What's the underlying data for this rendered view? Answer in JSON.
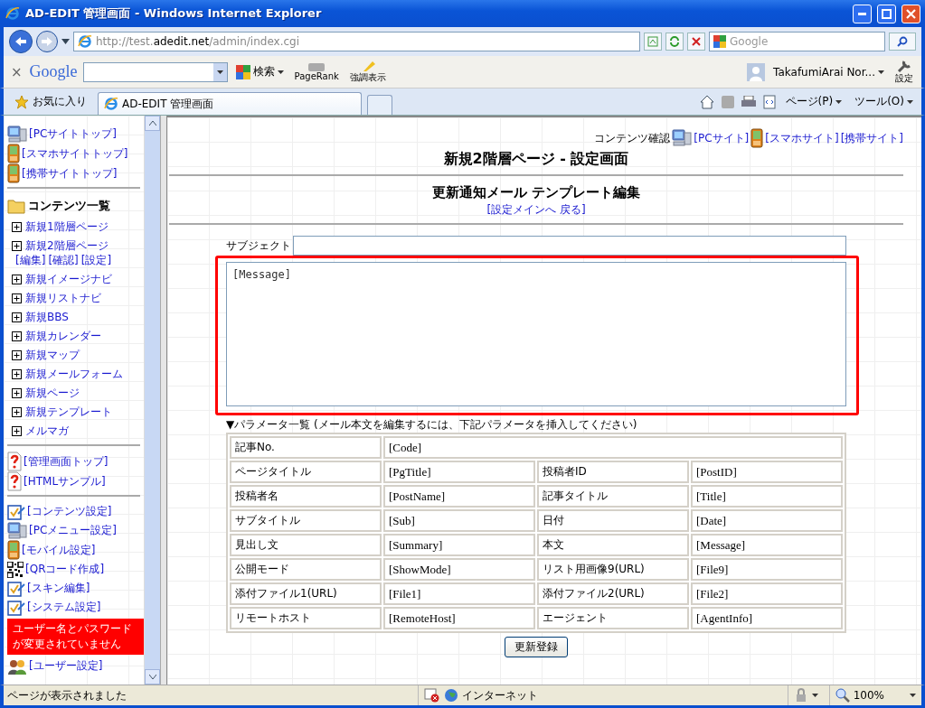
{
  "window": {
    "title": "AD-EDIT 管理画面 - Windows Internet Explorer"
  },
  "address_bar": {
    "url_prefix": "http://test.",
    "url_domain": "adedit.net",
    "url_path": "/admin/index.cgi"
  },
  "search_box": {
    "placeholder": "Google"
  },
  "google_toolbar": {
    "close": "×",
    "logo": "Google",
    "search_button": "検索",
    "pagerank": "PageRank",
    "highlight": "強調表示",
    "user": "TakafumiArai Nor...",
    "settings": "設定"
  },
  "tab_bar": {
    "favorites": "お気に入り",
    "tabs": [
      {
        "label": "AD-EDIT 管理画面",
        "selected": true
      }
    ],
    "page_menu": "ページ(P)",
    "tools_menu": "ツール(O)"
  },
  "sidebar": {
    "top_links": [
      {
        "kind": "pc",
        "label": "[PCサイトトップ]"
      },
      {
        "kind": "phone",
        "label": "[スマホサイトトップ]"
      },
      {
        "kind": "phone",
        "label": "[携帯サイトトップ]"
      }
    ],
    "contents": {
      "heading": "コンテンツ一覧",
      "items": [
        {
          "label": "新規1階層ページ",
          "expanded": false
        },
        {
          "label": "新規2階層ページ",
          "expanded": false,
          "actions": [
            "[編集]",
            "[確認]",
            "[設定]"
          ]
        },
        {
          "label": "新規イメージナビ",
          "expanded": false
        },
        {
          "label": "新規リストナビ",
          "expanded": false
        },
        {
          "label": "新規BBS",
          "expanded": false
        },
        {
          "label": "新規カレンダー",
          "expanded": false
        },
        {
          "label": "新規マップ",
          "expanded": false
        },
        {
          "label": "新規メールフォーム",
          "expanded": false
        },
        {
          "label": "新規ページ",
          "expanded": false
        },
        {
          "label": "新規テンプレート",
          "expanded": false
        },
        {
          "label": "メルマガ",
          "expanded": false
        }
      ]
    },
    "help_links": [
      {
        "kind": "help",
        "label": "[管理画面トップ]"
      },
      {
        "kind": "help",
        "label": "[HTMLサンプル]"
      }
    ],
    "settings_links": [
      {
        "kind": "check",
        "label": "[コンテンツ設定]"
      },
      {
        "kind": "pc",
        "label": "[PCメニュー設定]"
      },
      {
        "kind": "phone",
        "label": "[モバイル設定]"
      },
      {
        "kind": "qr",
        "label": "[QRコード作成]"
      },
      {
        "kind": "check",
        "label": "[スキン編集]"
      },
      {
        "kind": "check",
        "label": "[システム設定]"
      },
      {
        "kind": "warning",
        "label": "ユーザー名とパスワードが変更されていません"
      },
      {
        "kind": "users",
        "label": "[ユーザー設定]"
      }
    ]
  },
  "main": {
    "check_label": "コンテンツ確認",
    "check_links": [
      {
        "kind": "pc",
        "label": "[PCサイト]"
      },
      {
        "kind": "phone",
        "label": "[スマホサイト]"
      },
      {
        "kind": "none",
        "label": "[携帯サイト]"
      }
    ],
    "title": "新規2階層ページ - 設定画面",
    "subtitle": "更新通知メール テンプレート編集",
    "back_link": "[設定メインへ 戻る]",
    "subject_label": "サブジェクト",
    "body_value": "[Message]",
    "params_heading": "▼パラメータ一覧 (メール本文を編集するには、下記パラメータを挿入してください)",
    "params": [
      [
        "記事No.",
        "[Code]"
      ],
      [
        "ページタイトル",
        "[PgTitle]",
        "投稿者ID",
        "[PostID]"
      ],
      [
        "投稿者名",
        "[PostName]",
        "記事タイトル",
        "[Title]"
      ],
      [
        "サブタイトル",
        "[Sub]",
        "日付",
        "[Date]"
      ],
      [
        "見出し文",
        "[Summary]",
        "本文",
        "[Message]"
      ],
      [
        "公開モード",
        "[ShowMode]",
        "リスト用画像9(URL)",
        "[File9]"
      ],
      [
        "添付ファイル1(URL)",
        "[File1]",
        "添付ファイル2(URL)",
        "[File2]"
      ],
      [
        "リモートホスト",
        "[RemoteHost]",
        "エージェント",
        "[AgentInfo]"
      ]
    ],
    "submit_button": "更新登録"
  },
  "status_bar": {
    "message": "ページが表示されました",
    "zone": "インターネット",
    "zoom": "100%"
  }
}
